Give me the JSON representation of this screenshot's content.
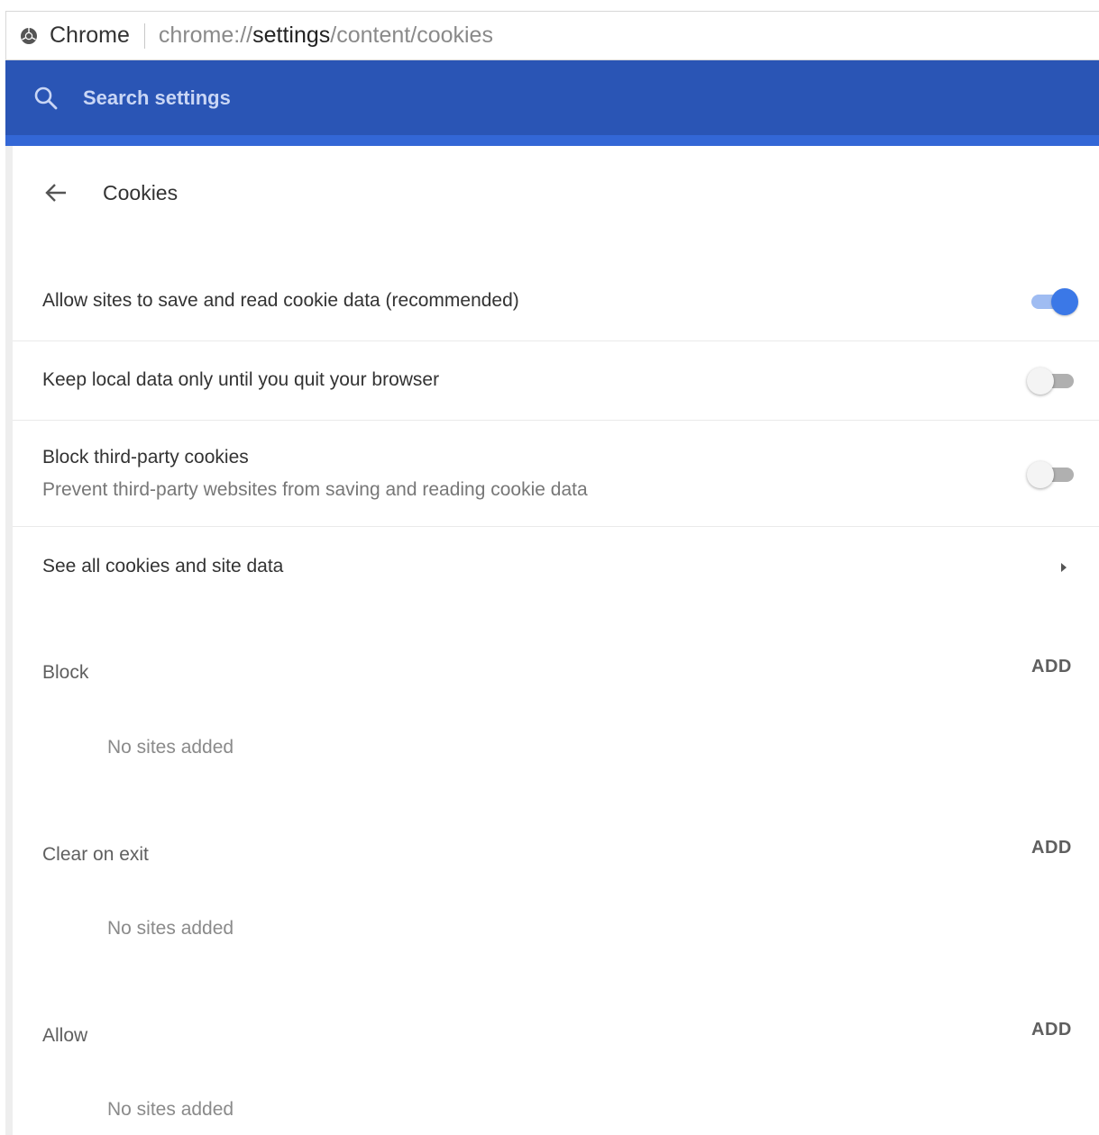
{
  "omnibox": {
    "app_name": "Chrome",
    "url_scheme": "chrome://",
    "url_host": "settings",
    "url_path": "/content/cookies"
  },
  "search": {
    "placeholder": "Search settings"
  },
  "page": {
    "title": "Cookies"
  },
  "settings": [
    {
      "label": "Allow sites to save and read cookie data (recommended)",
      "enabled": true
    },
    {
      "label": "Keep local data only until you quit your browser",
      "enabled": false
    },
    {
      "label": "Block third-party cookies",
      "sublabel": "Prevent third-party websites from saving and reading cookie data",
      "enabled": false
    }
  ],
  "see_all": {
    "label": "See all cookies and site data"
  },
  "sections": [
    {
      "title": "Block",
      "add_label": "ADD",
      "empty_text": "No sites added"
    },
    {
      "title": "Clear on exit",
      "add_label": "ADD",
      "empty_text": "No sites added"
    },
    {
      "title": "Allow",
      "add_label": "ADD",
      "empty_text": "No sites added"
    }
  ],
  "colors": {
    "header_blue": "#2a55b5",
    "toggle_on": "#3b78e7"
  },
  "icons": {
    "chrome": "chrome-logo-icon",
    "search": "search-icon",
    "back": "back-arrow-icon",
    "chevron": "chevron-right-icon"
  }
}
